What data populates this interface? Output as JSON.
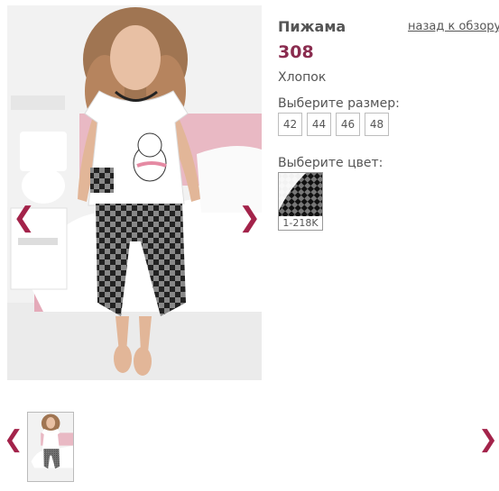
{
  "product": {
    "title": "Пижама",
    "price": "308",
    "material": "Хлопок"
  },
  "nav": {
    "back_link": "назад к обзору"
  },
  "size_section": {
    "label": "Выберите размер:",
    "sizes": [
      "42",
      "44",
      "46",
      "48"
    ]
  },
  "color_section": {
    "label": "Выберите цвет:",
    "swatch_code": "1-218K"
  },
  "icons": {
    "prev": "chevron-left-icon",
    "next": "chevron-right-icon",
    "arrow_color": "#a3234a"
  },
  "colors": {
    "price": "#8a2c4f",
    "text": "#555555"
  }
}
